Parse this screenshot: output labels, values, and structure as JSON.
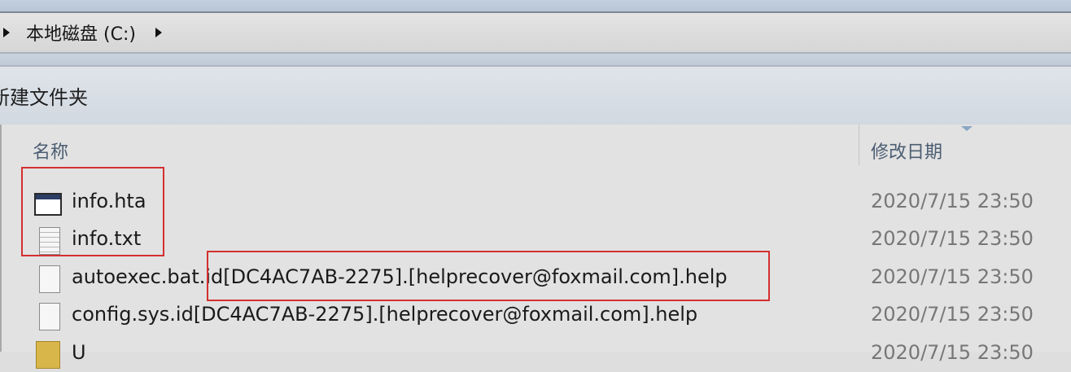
{
  "address_bar": {
    "path_label": "本地磁盘 (C:)"
  },
  "toolbar": {
    "new_folder_label": "新建文件夹"
  },
  "columns": {
    "name": "名称",
    "date_modified": "修改日期"
  },
  "files": [
    {
      "name": "info.hta",
      "date": "2020/7/15 23:50",
      "icon": "hta-window-icon"
    },
    {
      "name": "info.txt",
      "date": "2020/7/15 23:50",
      "icon": "text-file-icon"
    },
    {
      "name": "autoexec.bat.id[DC4AC7AB-2275].[helprecover@foxmail.com].help",
      "date": "2020/7/15 23:50",
      "icon": "file-icon"
    },
    {
      "name": "config.sys.id[DC4AC7AB-2275].[helprecover@foxmail.com].help",
      "date": "2020/7/15 23:50",
      "icon": "file-icon"
    },
    {
      "name": "U",
      "date": "2020/7/15 23:50",
      "icon": "folder-icon"
    }
  ],
  "colors": {
    "highlight": "#d43030",
    "header_text": "#4b5d72",
    "date_text": "#777777"
  }
}
